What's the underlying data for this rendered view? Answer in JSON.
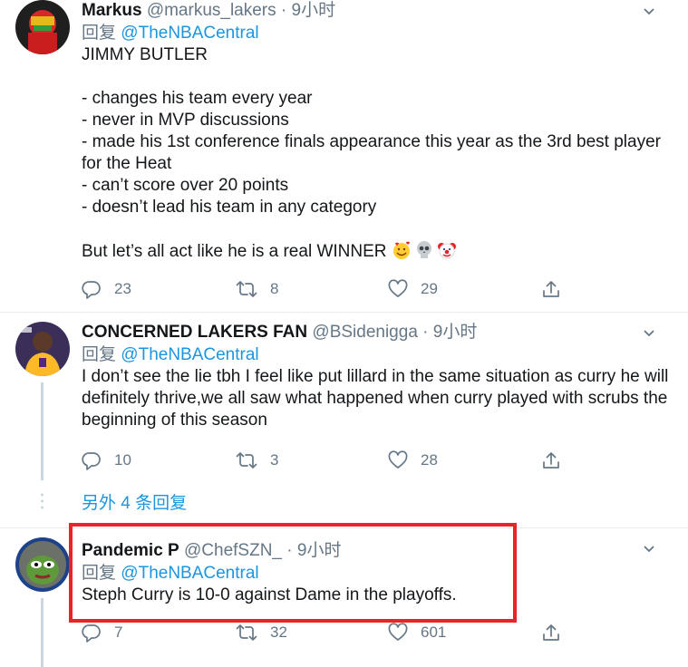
{
  "tweets": [
    {
      "name": "Markus",
      "handle": "@markus_lakers",
      "separator": "·",
      "time": "9小时",
      "reply_prefix": "回复",
      "reply_to": "@TheNBACentral",
      "body": "JIMMY BUTLER\n\n- changes his team every year\n- never in MVP discussions\n- made his 1st conference finals appearance this year as the 3rd best player for the Heat\n- can’t score over 20 points\n- doesn’t lead his team in any category\n\nBut let’s all act like he is a real WINNER",
      "emojis": [
        "smiling-face-with-hearts",
        "skull",
        "clown-face"
      ],
      "replies": "23",
      "retweets": "8",
      "likes": "29"
    },
    {
      "name": "CONCERNED LAKERS FAN",
      "handle": "@BSidenigga",
      "separator": "·",
      "time": "9小时",
      "reply_prefix": "回复",
      "reply_to": "@TheNBACentral",
      "body": "I don’t see the lie tbh I feel like put lillard in the same situation as curry he will definitely thrive,we all saw what happened when curry played with scrubs the beginning of this season",
      "replies": "10",
      "retweets": "3",
      "likes": "28"
    },
    {
      "name": "Pandemic P",
      "handle": "@ChefSZN_",
      "separator": "·",
      "time": "9小时",
      "reply_prefix": "回复",
      "reply_to": "@TheNBACentral",
      "body": "Steph Curry is 10-0 against Dame in the playoffs.",
      "replies": "7",
      "retweets": "32",
      "likes": "601"
    }
  ],
  "more_replies": "另外 4 条回复",
  "colors": {
    "link": "#1b95e0",
    "muted": "#657786",
    "highlight_border": "#e8242b",
    "divider": "#e6ecf0",
    "thread_line": "#ccd6dd"
  },
  "icons": [
    "chevron-down-icon",
    "reply-icon",
    "retweet-icon",
    "like-icon",
    "share-icon",
    "more-dots-icon"
  ]
}
